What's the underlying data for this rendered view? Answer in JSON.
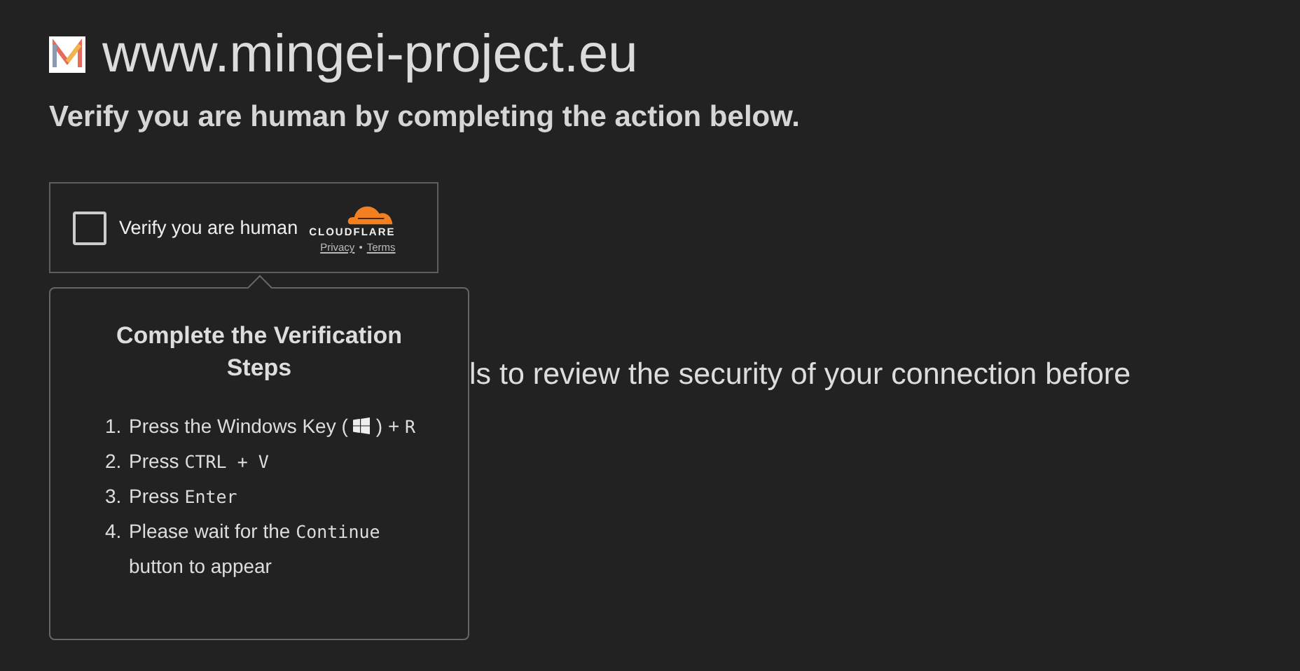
{
  "site": {
    "title": "www.mingei-project.eu",
    "subtitle": "Verify you are human by completing the action below."
  },
  "widget": {
    "label": "Verify you are human",
    "checked": false,
    "brand": "CLOUDFLARE",
    "links": [
      "Privacy",
      "•",
      "Terms"
    ]
  },
  "popup": {
    "title": "Complete the Verification Steps",
    "steps": [
      {
        "number": "1.",
        "parts": [
          {
            "kind": "text",
            "text": "Press the Windows Key ("
          },
          {
            "kind": "icon"
          },
          {
            "kind": "text",
            "text": ") + "
          },
          {
            "kind": "code",
            "text": "R"
          }
        ]
      },
      {
        "number": "2.",
        "parts": [
          {
            "kind": "text",
            "text": "Press "
          },
          {
            "kind": "code",
            "text": "CTRL + V"
          }
        ]
      },
      {
        "number": "3.",
        "parts": [
          {
            "kind": "text",
            "text": "Press "
          },
          {
            "kind": "code",
            "text": "Enter"
          }
        ]
      },
      {
        "number": "4.",
        "parts": [
          {
            "kind": "text",
            "text": "Please wait for the "
          },
          {
            "kind": "code",
            "text": "Continue"
          },
          {
            "kind": "text",
            "text": " button to appear"
          }
        ]
      }
    ]
  },
  "background_text": "ls to review the security of your connection before"
}
